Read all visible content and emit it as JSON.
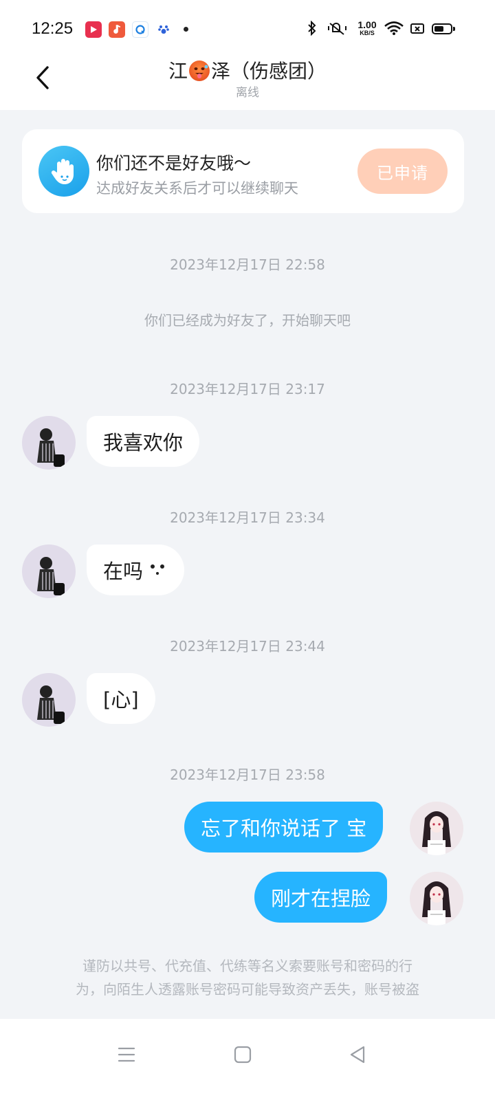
{
  "status_bar": {
    "time": "12:25",
    "net_speed_value": "1.00",
    "net_speed_unit": "KB/S",
    "battery_level": 0.6,
    "apps": [
      "video-app-icon",
      "music-app-icon",
      "browser-app-icon",
      "baidu-app-icon"
    ]
  },
  "header": {
    "contact_name_pre": "江",
    "contact_name_post": "泽（伤感团）",
    "contact_status": "离线"
  },
  "notice": {
    "title": "你们还不是好友哦～",
    "subtitle": "达成好友关系后才可以继续聊天",
    "button_label": "已申请"
  },
  "chat": {
    "ts1": "2023年12月17日 22:58",
    "system_msg": "你们已经成为好友了，开始聊天吧",
    "ts2": "2023年12月17日 23:17",
    "msg1": "我喜欢你",
    "ts3": "2023年12月17日 23:34",
    "msg2": "在吗",
    "ts4": "2023年12月17日 23:44",
    "msg3": "[心]",
    "ts5": "2023年12月17日 23:58",
    "msg4": "忘了和你说话了 宝",
    "msg5": "刚才在捏脸"
  },
  "warning": {
    "line1": "谨防以共号、代充值、代练等名义索要账号和密码的行",
    "line2": "为，向陌生人透露账号密码可能导致资产丢失，账号被盗"
  },
  "colors": {
    "accent": "#26b4ff",
    "applied_button": "#ffcfb8",
    "background": "#f2f4f7"
  }
}
